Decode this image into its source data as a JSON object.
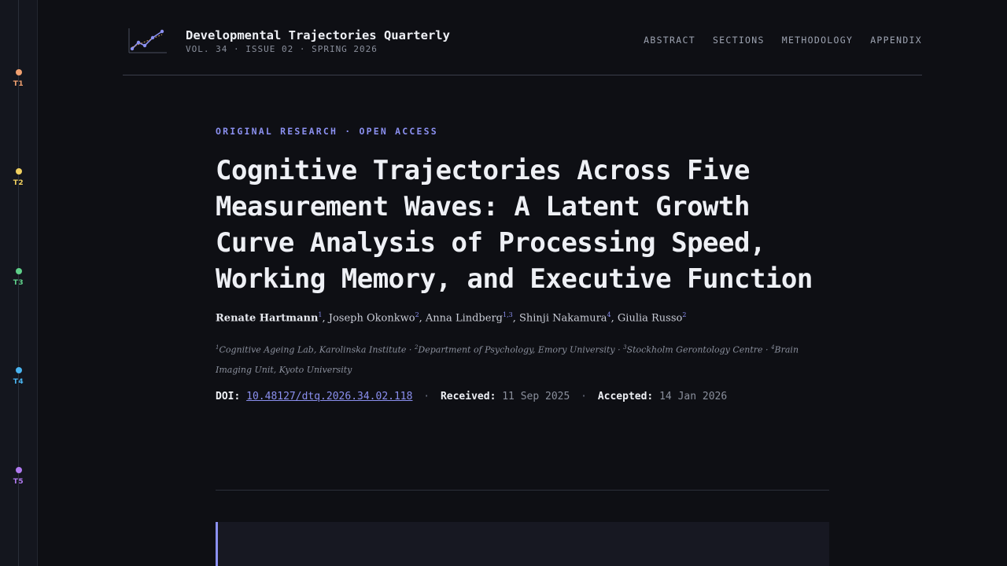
{
  "rail": {
    "waves": [
      {
        "label": "T1",
        "color": "#f0a070"
      },
      {
        "label": "T2",
        "color": "#f0d060"
      },
      {
        "label": "T3",
        "color": "#5fd08a"
      },
      {
        "label": "T4",
        "color": "#4ab4f0"
      },
      {
        "label": "T5",
        "color": "#b07af0"
      }
    ]
  },
  "header": {
    "journal_title": "Developmental Trajectories Quarterly",
    "journal_meta": "VOL. 34 · ISSUE 02 · SPRING 2026",
    "logo_icon": "trend-chart-icon",
    "nav": [
      "ABSTRACT",
      "SECTIONS",
      "METHODOLOGY",
      "APPENDIX"
    ]
  },
  "article": {
    "kicker": "ORIGINAL RESEARCH · OPEN ACCESS",
    "title": "Cognitive Trajectories Across Five Measurement Waves: A Latent Growth Curve Analysis of Processing Speed, Working Memory, and Executive Function",
    "authors": [
      {
        "name": "Renate Hartmann",
        "sup": "1"
      },
      {
        "name": "Joseph Okonkwo",
        "sup": "2"
      },
      {
        "name": "Anna Lindberg",
        "sup": "1,3"
      },
      {
        "name": "Shinji Nakamura",
        "sup": "4"
      },
      {
        "name": "Giulia Russo",
        "sup": "2"
      }
    ],
    "affiliations": [
      {
        "sup": "1",
        "text": "Cognitive Ageing Lab, Karolinska Institute"
      },
      {
        "sup": "2",
        "text": "Department of Psychology, Emory University"
      },
      {
        "sup": "3",
        "text": "Stockholm Gerontology Centre"
      },
      {
        "sup": "4",
        "text": "Brain Imaging Unit, Kyoto University"
      }
    ],
    "doi_label": "DOI:",
    "doi": "10.48127/dtq.2026.34.02.118",
    "received_label": "Received:",
    "received": "11 Sep 2025",
    "accepted_label": "Accepted:",
    "accepted": "14 Jan 2026"
  },
  "colors": {
    "accent": "#8b90f0",
    "background": "#0e0f14"
  }
}
